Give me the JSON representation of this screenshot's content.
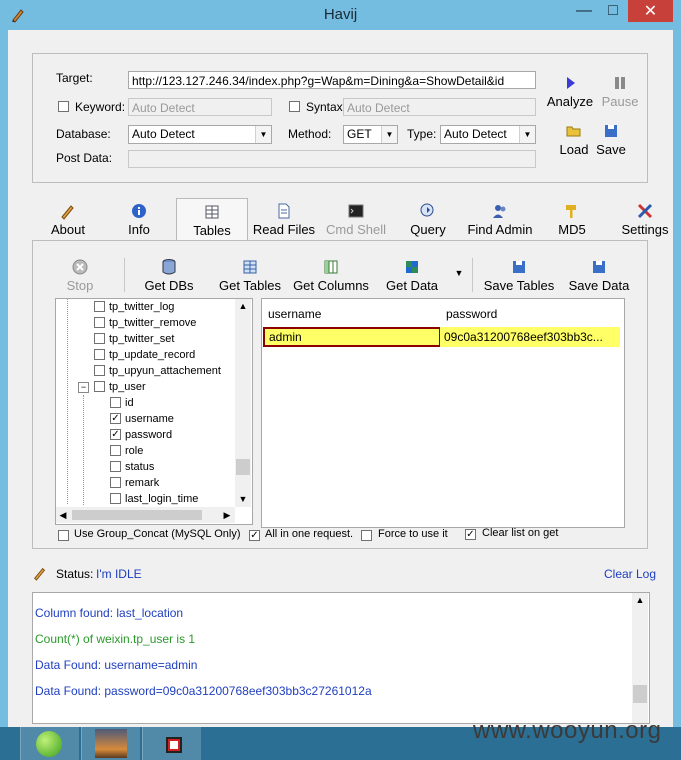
{
  "window": {
    "title": "Havij",
    "minimize": "—",
    "maximize": "□",
    "close": "✕"
  },
  "form": {
    "target_label": "Target:",
    "target_value": "http://123.127.246.34/index.php?g=Wap&m=Dining&a=ShowDetail&id",
    "keyword_label": "Keyword:",
    "keyword_placeholder": "Auto Detect",
    "syntax_label": "Syntax:",
    "syntax_placeholder": "Auto Detect",
    "database_label": "Database:",
    "database_value": "Auto Detect",
    "method_label": "Method:",
    "method_value": "GET",
    "type_label": "Type:",
    "type_value": "Auto Detect",
    "postdata_label": "Post Data:",
    "analyze": "Analyze",
    "pause": "Pause",
    "load": "Load",
    "save": "Save"
  },
  "tabs": [
    {
      "label": "About",
      "icon": "pen-icon"
    },
    {
      "label": "Info",
      "icon": "info-icon"
    },
    {
      "label": "Tables",
      "icon": "table-icon",
      "active": true
    },
    {
      "label": "Read Files",
      "icon": "file-icon"
    },
    {
      "label": "Cmd Shell",
      "icon": "terminal-icon",
      "disabled": true
    },
    {
      "label": "Query",
      "icon": "query-icon"
    },
    {
      "label": "Find Admin",
      "icon": "users-icon"
    },
    {
      "label": "MD5",
      "icon": "key-icon"
    },
    {
      "label": "Settings",
      "icon": "tools-icon"
    }
  ],
  "toolbar": {
    "stop": "Stop",
    "get_dbs": "Get DBs",
    "get_tables": "Get Tables",
    "get_columns": "Get Columns",
    "get_data": "Get Data",
    "save_tables": "Save Tables",
    "save_data": "Save Data"
  },
  "tree": {
    "items": [
      {
        "label": "tp_twitter_log",
        "checked": false
      },
      {
        "label": "tp_twitter_remove",
        "checked": false
      },
      {
        "label": "tp_twitter_set",
        "checked": false
      },
      {
        "label": "tp_update_record",
        "checked": false
      },
      {
        "label": "tp_upyun_attachement",
        "checked": false
      },
      {
        "label": "tp_user",
        "checked": false,
        "expanded": true
      },
      {
        "label": "id",
        "checked": false
      },
      {
        "label": "username",
        "checked": true
      },
      {
        "label": "password",
        "checked": true
      },
      {
        "label": "role",
        "checked": false
      },
      {
        "label": "status",
        "checked": false
      },
      {
        "label": "remark",
        "checked": false
      },
      {
        "label": "last_login_time",
        "checked": false
      }
    ]
  },
  "grid": {
    "columns": [
      "username",
      "password"
    ],
    "rows": [
      [
        "admin",
        "09c0a31200768eef303bb3c..."
      ]
    ]
  },
  "options": {
    "group_concat": "Use Group_Concat (MySQL Only)",
    "all_in_one": "All in one request.",
    "force": "Force to use it",
    "clear_list": "Clear list on get"
  },
  "status": {
    "label": "Status:",
    "value": "I'm IDLE",
    "clear_log": "Clear Log"
  },
  "log": [
    {
      "text": "Column found: last_location",
      "color": "#1f3fbf"
    },
    {
      "text": "Count(*) of weixin.tp_user is 1",
      "color": "#2a9a2a"
    },
    {
      "text": "Data Found: username=admin",
      "color": "#1f3fbf"
    },
    {
      "text": "Data Found: password=09c0a31200768eef303bb3c27261012a",
      "color": "#1f3fbf"
    }
  ],
  "watermark": "www.wooyun.org",
  "colors": {
    "highlight": "#ffff66",
    "selected_border": "#8b0000",
    "accent_blue": "#1f3fbf"
  }
}
